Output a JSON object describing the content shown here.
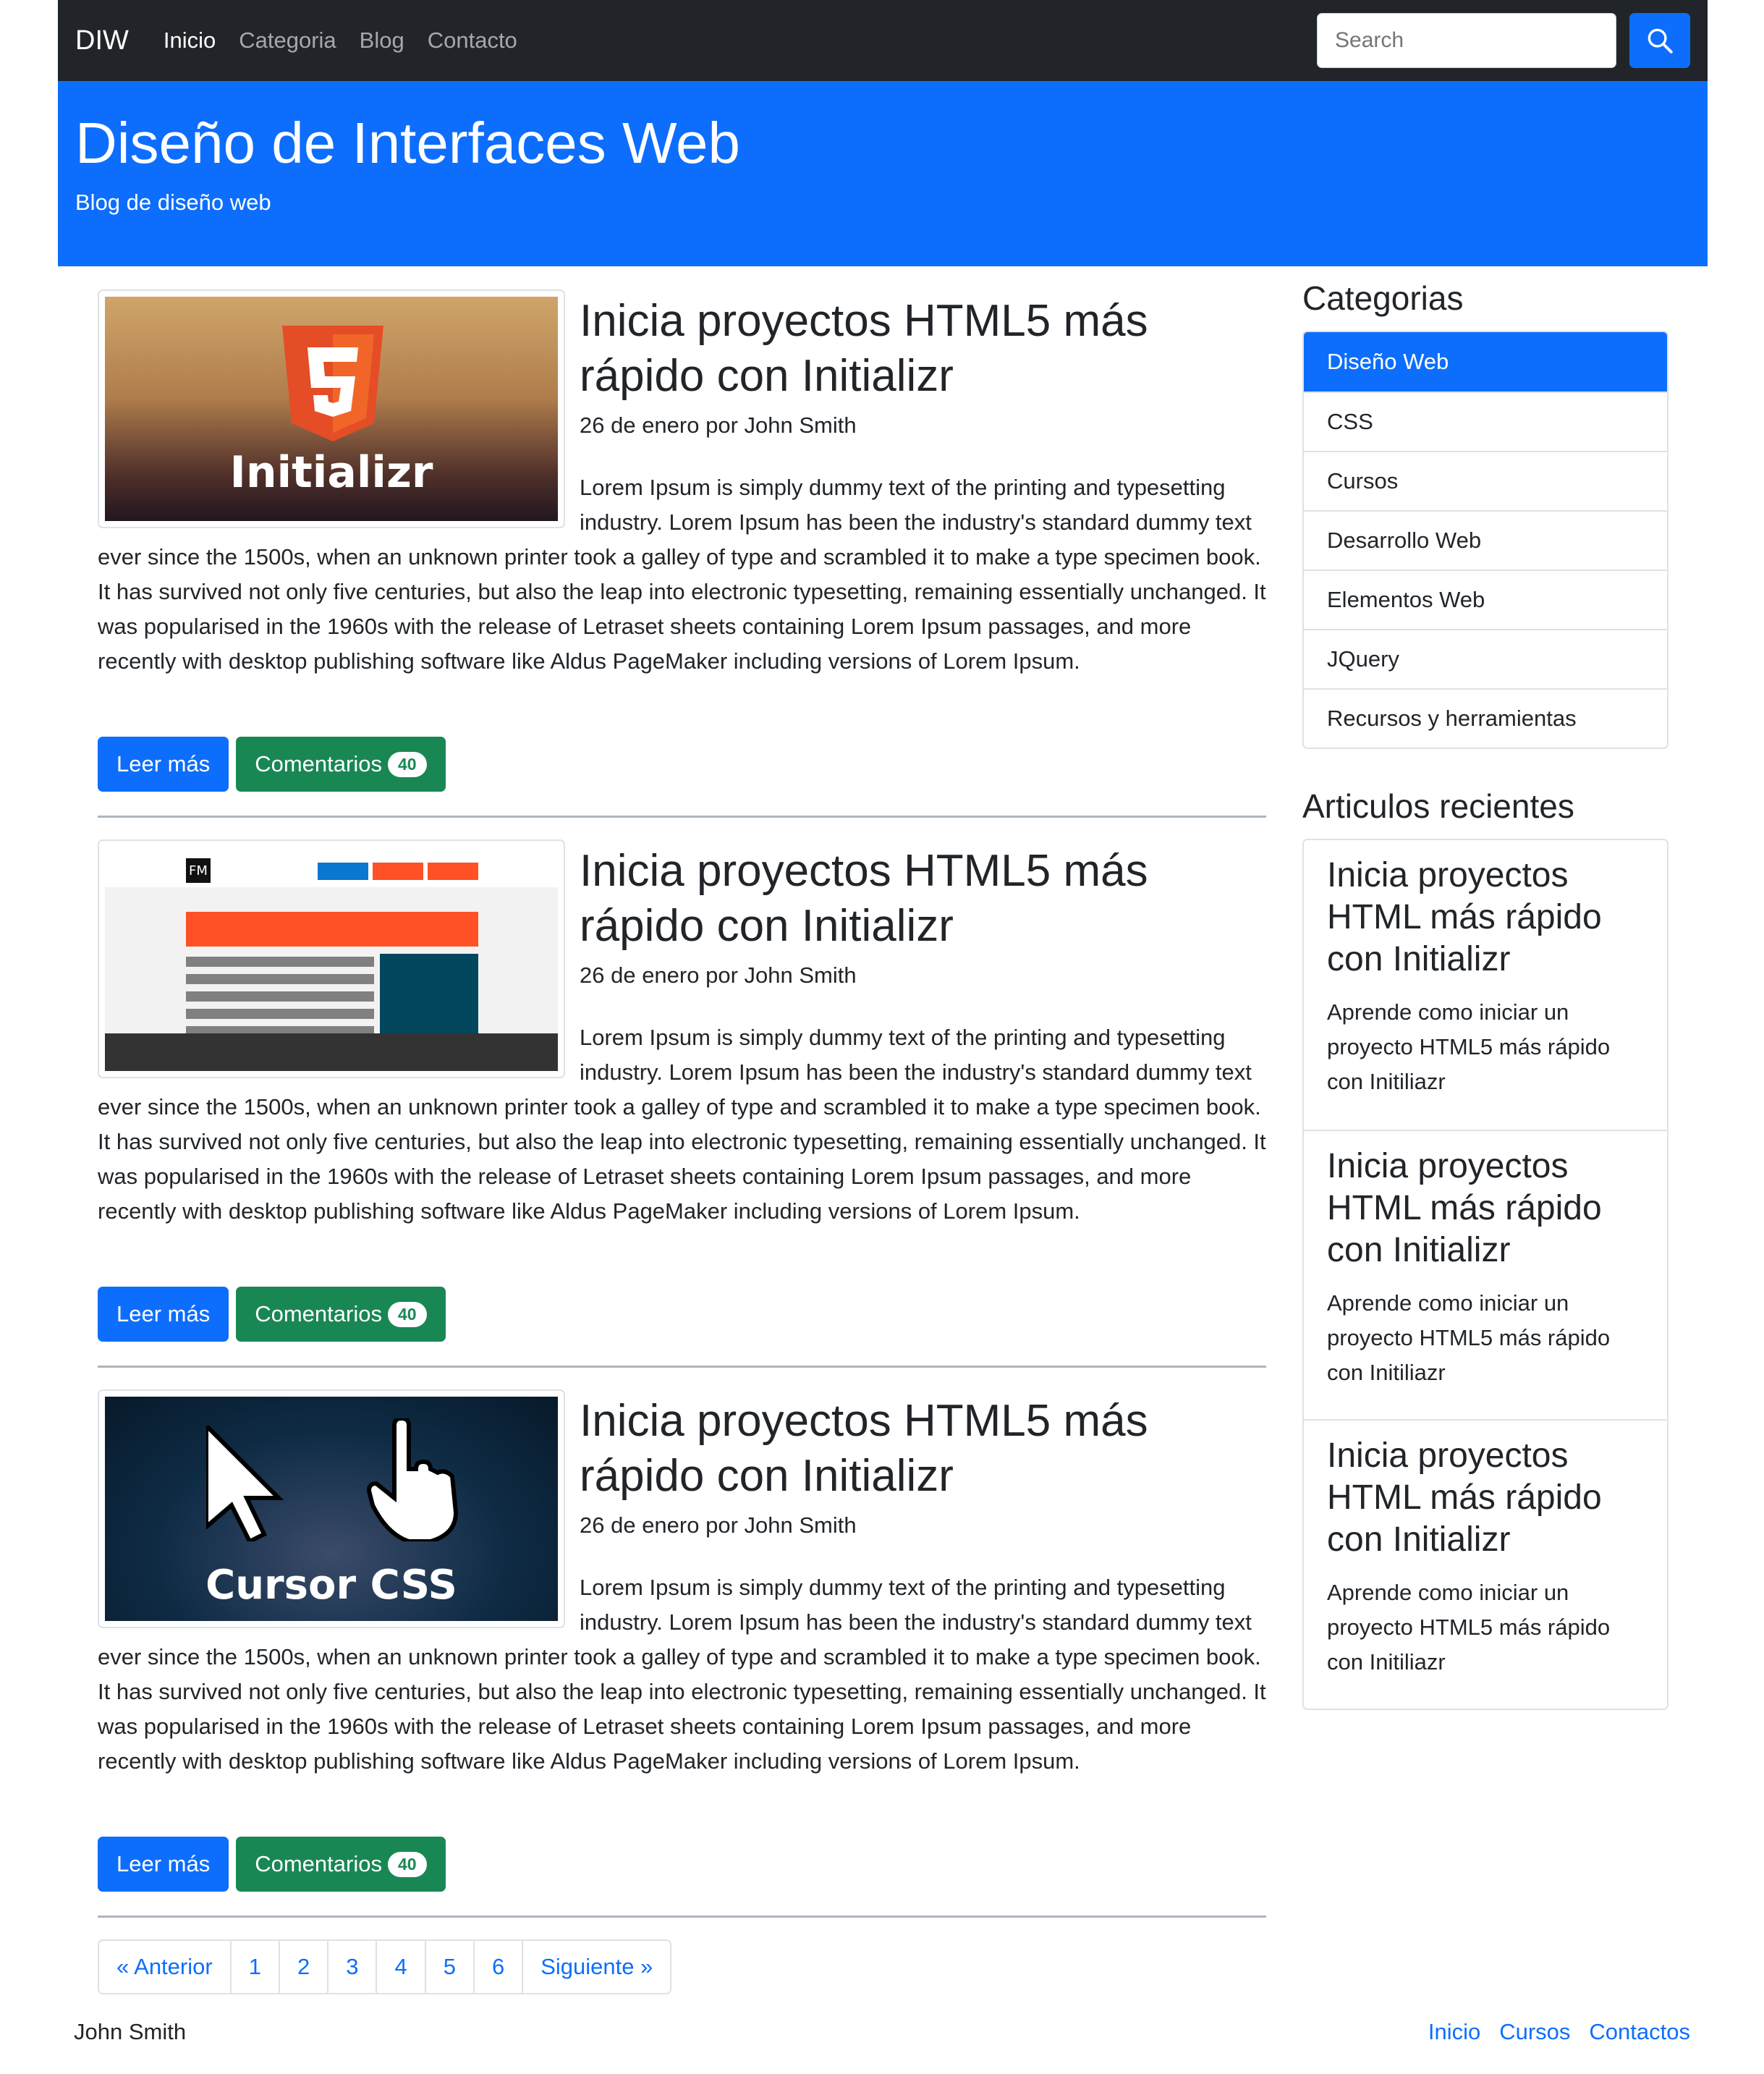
{
  "navbar": {
    "brand": "DIW",
    "links": [
      "Inicio",
      "Categoria",
      "Blog",
      "Contacto"
    ],
    "search_placeholder": "Search"
  },
  "hero": {
    "title": "Diseño de Interfaces Web",
    "subtitle": "Blog de diseño web"
  },
  "posts": [
    {
      "thumb": "Initializr",
      "title": "Inicia proyectos HTML5 más rápido con Initializr",
      "meta": "26 de enero por John Smith",
      "text": "Lorem Ipsum is simply dummy text of the printing and typesetting industry. Lorem Ipsum has been the industry's standard dummy text ever since the 1500s, when an unknown printer took a galley of type and scrambled it to make a type specimen book. It has survived not only five centuries, but also the leap into electronic typesetting, remaining essentially unchanged. It was popularised in the 1960s with the release of Letraset sheets containing Lorem Ipsum passages, and more recently with desktop publishing software like Aldus PageMaker including versions of Lorem Ipsum.",
      "read_more": "Leer más",
      "comments": "Comentarios",
      "comments_count": "40"
    },
    {
      "thumb": "FM",
      "title": "Inicia proyectos HTML5 más rápido con Initializr",
      "meta": "26 de enero por John Smith",
      "text": "Lorem Ipsum is simply dummy text of the printing and typesetting industry. Lorem Ipsum has been the industry's standard dummy text ever since the 1500s, when an unknown printer took a galley of type and scrambled it to make a type specimen book. It has survived not only five centuries, but also the leap into electronic typesetting, remaining essentially unchanged. It was popularised in the 1960s with the release of Letraset sheets containing Lorem Ipsum passages, and more recently with desktop publishing software like Aldus PageMaker including versions of Lorem Ipsum.",
      "read_more": "Leer más",
      "comments": "Comentarios",
      "comments_count": "40"
    },
    {
      "thumb": "Cursor CSS",
      "title": "Inicia proyectos HTML5 más rápido con Initializr",
      "meta": "26 de enero por John Smith",
      "text": "Lorem Ipsum is simply dummy text of the printing and typesetting industry. Lorem Ipsum has been the industry's standard dummy text ever since the 1500s, when an unknown printer took a galley of type and scrambled it to make a type specimen book. It has survived not only five centuries, but also the leap into electronic typesetting, remaining essentially unchanged. It was popularised in the 1960s with the release of Letraset sheets containing Lorem Ipsum passages, and more recently with desktop publishing software like Aldus PageMaker including versions of Lorem Ipsum.",
      "read_more": "Leer más",
      "comments": "Comentarios",
      "comments_count": "40"
    }
  ],
  "pagination": [
    "« Anterior",
    "1",
    "2",
    "3",
    "4",
    "5",
    "6",
    "Siguiente »"
  ],
  "sidebar": {
    "categories_title": "Categorias",
    "categories": [
      "Diseño Web",
      "CSS",
      "Cursos",
      "Desarrollo Web",
      "Elementos Web",
      "JQuery",
      "Recursos y herramientas"
    ],
    "recent_title": "Articulos recientes",
    "recent": [
      {
        "title": "Inicia proyectos HTML más rápido con Initializr",
        "text": "Aprende como iniciar un proyecto HTML5 más rápido con Initiliazr"
      },
      {
        "title": "Inicia proyectos HTML más rápido con Initializr",
        "text": "Aprende como iniciar un proyecto HTML5 más rápido con Initiliazr"
      },
      {
        "title": "Inicia proyectos HTML más rápido con Initializr",
        "text": "Aprende como iniciar un proyecto HTML5 más rápido con Initiliazr"
      }
    ]
  },
  "footer": {
    "author": "John Smith",
    "links": [
      "Inicio",
      "Cursos",
      "Contactos"
    ]
  },
  "colors": {
    "primary": "#0d6efd",
    "success": "#198754",
    "navbar": "#212529"
  }
}
